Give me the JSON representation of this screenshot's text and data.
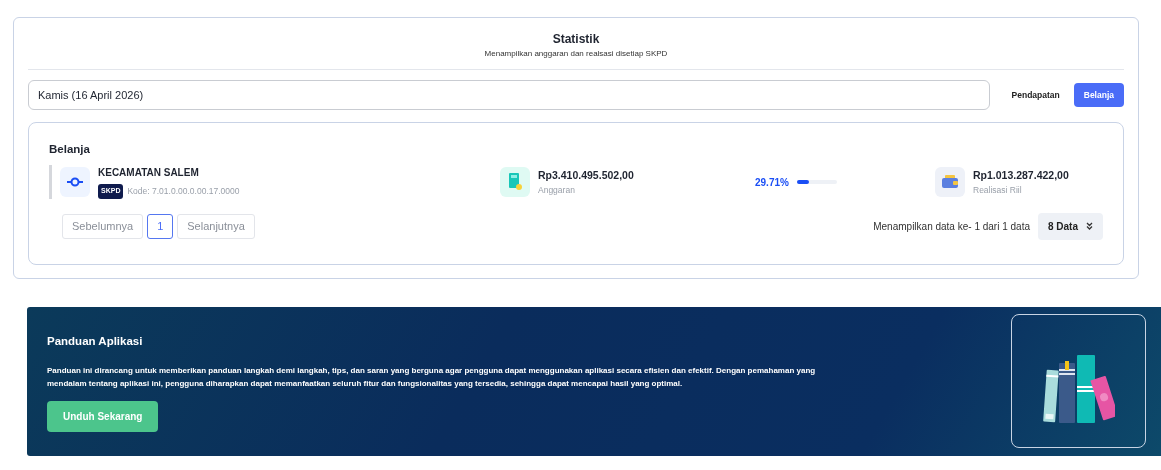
{
  "header": {
    "title": "Statistik",
    "subtitle": "Menampilkan anggaran dan realsasi disetiap SKPD"
  },
  "date_field": {
    "value": "Kamis (16 April 2026)"
  },
  "tabs": [
    {
      "label": "Pendapatan",
      "selected": false
    },
    {
      "label": "Belanja",
      "selected": true
    }
  ],
  "section_title": "Belanja",
  "rows": [
    {
      "name": "KECAMATAN SALEM",
      "badge": "SKPD",
      "code": "Kode: 7.01.0.00.0.00.17.0000",
      "budget": "Rp3.410.495.502,00",
      "budget_label": "Anggaran",
      "percent": "29.71%",
      "level": 0.2971,
      "realization": "Rp1.013.287.422,00",
      "realization_label": "Realisasi Riil"
    }
  ],
  "pagination": {
    "previous": "Sebelumnya",
    "pages": [
      {
        "label": "1",
        "selected": true
      }
    ],
    "next": "Selanjutnya",
    "info": "Menampilkan data ke- 1 dari 1 data",
    "page_size": "8 Data"
  },
  "guide": {
    "title": "Panduan Aplikasi",
    "text": "Panduan ini dirancang untuk memberikan panduan langkah demi langkah, tips, dan saran yang berguna agar pengguna dapat menggunakan aplikasi secara efisien dan efektif. Dengan pemahaman yang mendalam tentang aplikasi ini, pengguna diharapkan dapat memanfaatkan seluruh fitur dan fungsionalitas yang tersedia, sehingga dapat mencapai hasil yang optimal.",
    "button": "Unduh Sekarang"
  }
}
